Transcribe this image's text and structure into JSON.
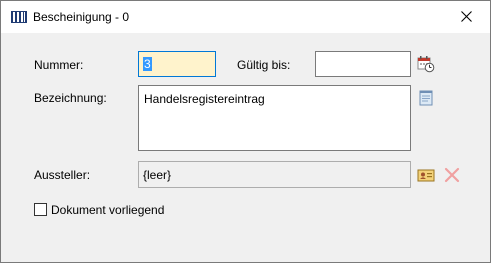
{
  "window": {
    "title": "Bescheinigung - 0",
    "app_icon": "library-books-icon",
    "close_icon": "close-icon"
  },
  "form": {
    "nummer_label": "Nummer:",
    "nummer_value": "3",
    "gueltig_label": "Gültig bis:",
    "gueltig_value": "",
    "gueltig_icon": "calendar-clock-icon",
    "bezeichnung_label": "Bezeichnung:",
    "bezeichnung_value": "Handelsregistereintrag",
    "bezeichnung_icon": "notepad-icon",
    "aussteller_label": "Aussteller:",
    "aussteller_value": "{leer}",
    "aussteller_select_icon": "address-card-icon",
    "aussteller_clear_icon": "clear-x-icon",
    "dokument_label": "Dokument vorliegend",
    "dokument_checked": false
  },
  "colors": {
    "window_bg": "#f0f0f0",
    "titlebar_bg": "#ffffff",
    "focus_border": "#0078d7",
    "focused_field_bg": "#fff3cc",
    "selection_bg": "#3399ff",
    "clear_icon_color": "#f0a0a0"
  }
}
